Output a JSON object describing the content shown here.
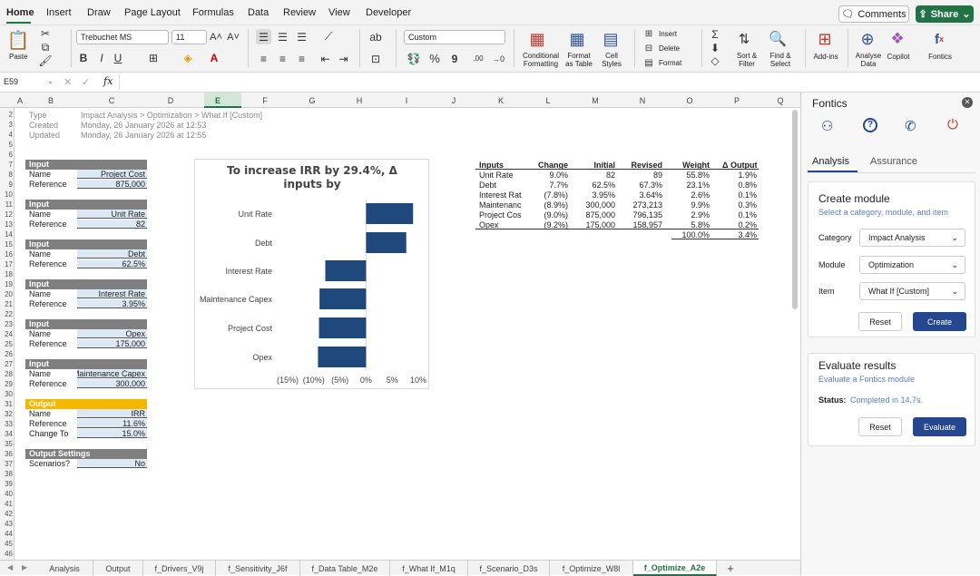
{
  "menu": {
    "tabs": [
      "Home",
      "Insert",
      "Draw",
      "Page Layout",
      "Formulas",
      "Data",
      "Review",
      "View",
      "Developer"
    ],
    "comments": "Comments",
    "share": "Share"
  },
  "ribbon": {
    "paste": "Paste",
    "font_name": "Trebuchet MS",
    "font_size": "11",
    "number_format": "Custom",
    "conditional": [
      "Conditional",
      "Formatting"
    ],
    "format_table": [
      "Format",
      "as Table"
    ],
    "cell_styles": [
      "Cell",
      "Styles"
    ],
    "insert": "Insert",
    "delete": "Delete",
    "format": "Format",
    "sort": [
      "Sort &",
      "Filter"
    ],
    "find": [
      "Find &",
      "Select"
    ],
    "addins": "Add-ins",
    "analyse": [
      "Analyse",
      "Data"
    ],
    "copilot": "Copilot",
    "fontics": "Fontics",
    "bold": "B",
    "italic": "I",
    "underline": "U",
    "percent": "%",
    "comma": "9",
    "inc_dec": ".00"
  },
  "formula_bar": {
    "name_box": "E59",
    "fx": "fx",
    "value": ""
  },
  "columns": [
    "A",
    "B",
    "C",
    "D",
    "E",
    "F",
    "G",
    "H",
    "I",
    "J",
    "K",
    "L",
    "M",
    "N",
    "O",
    "P",
    "Q"
  ],
  "rows": [
    "2",
    "3",
    "4",
    "5",
    "6",
    "7",
    "8",
    "9",
    "10",
    "11",
    "12",
    "13",
    "14",
    "15",
    "16",
    "17",
    "18",
    "19",
    "20",
    "21",
    "22",
    "23",
    "24",
    "25",
    "26",
    "27",
    "28",
    "29",
    "30",
    "31",
    "32",
    "33",
    "34",
    "35",
    "36",
    "37",
    "38",
    "39",
    "40",
    "41",
    "42",
    "43",
    "44",
    "45",
    "46"
  ],
  "meta": [
    {
      "k": "Type",
      "v": "Impact Analysis > Optimization > What If [Custom]"
    },
    {
      "k": "Created",
      "v": "Monday, 26 January 2026 at 12:53"
    },
    {
      "k": "Updated",
      "v": "Monday, 26 January 2026 at 12:55"
    }
  ],
  "inputs": [
    {
      "title": "Input",
      "name_label": "Name",
      "name": "Project Cost",
      "ref_label": "Reference",
      "ref": "875,000"
    },
    {
      "title": "Input",
      "name_label": "Name",
      "name": "Unit Rate",
      "ref_label": "Reference",
      "ref": "82"
    },
    {
      "title": "Input",
      "name_label": "Name",
      "name": "Debt",
      "ref_label": "Reference",
      "ref": "62.5%"
    },
    {
      "title": "Input",
      "name_label": "Name",
      "name": "Interest Rate",
      "ref_label": "Reference",
      "ref": "3.95%"
    },
    {
      "title": "Input",
      "name_label": "Name",
      "name": "Opex",
      "ref_label": "Reference",
      "ref": "175,000"
    },
    {
      "title": "Input",
      "name_label": "Name",
      "name": "Maintenance Capex",
      "ref_label": "Reference",
      "ref": "300,000"
    }
  ],
  "output": {
    "title": "Output",
    "name_label": "Name",
    "name": "IRR",
    "ref_label": "Reference",
    "ref": "11.6%",
    "change_label": "Change To",
    "change": "15.0%"
  },
  "output_settings": {
    "title": "Output Settings",
    "label": "Scenarios?",
    "value": "No"
  },
  "chart_data": {
    "type": "bar",
    "orientation": "horizontal",
    "title": "To increase IRR by 29.4%, Δ inputs by",
    "categories": [
      "Unit Rate",
      "Debt",
      "Interest Rate",
      "Maintenance Capex",
      "Project Cost",
      "Opex"
    ],
    "values": [
      9.0,
      7.7,
      -7.8,
      -8.9,
      -9.0,
      -9.2
    ],
    "xlim": [
      -15,
      10
    ],
    "tick_values": [
      -15,
      -10,
      -5,
      0,
      5,
      10
    ],
    "tick_labels": [
      "(15%)",
      "(10%)",
      "(5%)",
      "0%",
      "5%",
      "10%"
    ],
    "bar_color": "#1f497d",
    "grid": false
  },
  "table": {
    "headers": [
      "Inputs",
      "Change",
      "Initial",
      "Revised",
      "Weight",
      "Δ Output"
    ],
    "rows": [
      [
        "Unit Rate",
        "9.0%",
        "82",
        "89",
        "55.8%",
        "1.9%"
      ],
      [
        "Debt",
        "7.7%",
        "62.5%",
        "67.3%",
        "23.1%",
        "0.8%"
      ],
      [
        "Interest Rat",
        "(7.8%)",
        "3.95%",
        "3.64%",
        "2.6%",
        "0.1%"
      ],
      [
        "Maintenanc",
        "(8.9%)",
        "300,000",
        "273,213",
        "9.9%",
        "0.3%"
      ],
      [
        "Project Cos",
        "(9.0%)",
        "875,000",
        "796,135",
        "2.9%",
        "0.1%"
      ],
      [
        "Opex",
        "(9.2%)",
        "175,000",
        "158,957",
        "5.8%",
        "0.2%"
      ]
    ],
    "totals": [
      "100.0%",
      "3.4%"
    ]
  },
  "sheet_tabs": [
    "Analysis",
    "Output",
    "f_Drivers_V9j",
    "f_Sensitivity_J6f",
    "f_Data Table_M2e",
    "f_What If_M1q",
    "f_Scenario_D3s",
    "f_Optimize_W8l",
    "f_Optimize_A2e"
  ],
  "panel": {
    "title": "Fontics",
    "tabs": [
      "Analysis",
      "Assurance"
    ],
    "create": {
      "title": "Create module",
      "subtitle": "Select a category, module, and item",
      "category_label": "Category",
      "category": "Impact Analysis",
      "module_label": "Module",
      "module": "Optimization",
      "item_label": "Item",
      "item": "What If [Custom]",
      "reset": "Reset",
      "create": "Create"
    },
    "evaluate": {
      "title": "Evaluate results",
      "subtitle": "Evaluate a Fontics module",
      "status_label": "Status:",
      "status": "Completed in 14.7s.",
      "reset": "Reset",
      "evaluate": "Evaluate"
    }
  },
  "colors": {
    "accent_green": "#217346",
    "header_gray": "#7f7f7f",
    "output_orange": "#f5b800",
    "value_blue": "#dde8f5",
    "bar": "#1f497d",
    "primary_button": "#24478f"
  }
}
